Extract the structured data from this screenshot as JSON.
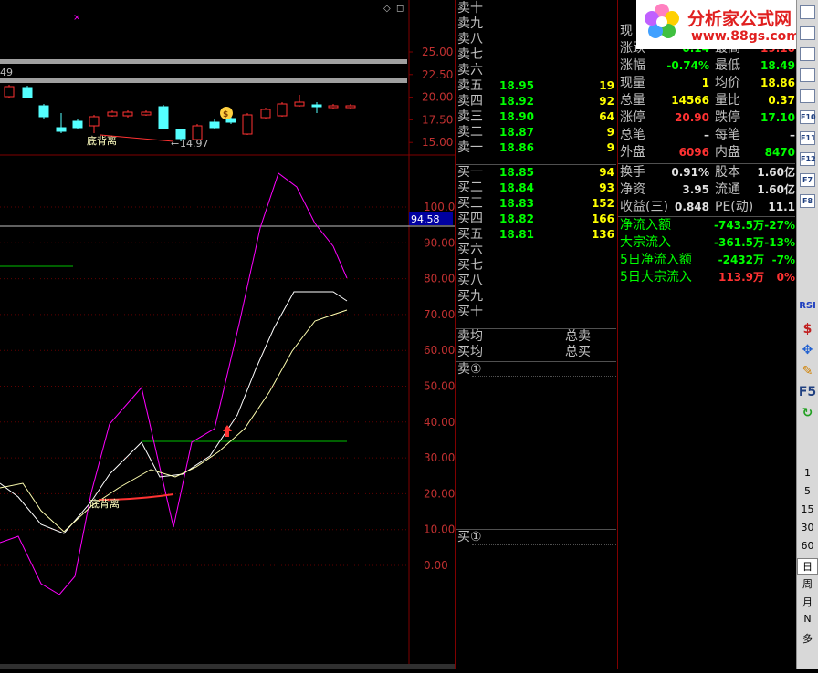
{
  "chart": {
    "price_axis": [
      "25.00",
      "22.50",
      "20.00",
      "17.50",
      "15.00"
    ],
    "indicator_axis": [
      "100.0",
      "90.00",
      "80.00",
      "70.00",
      "60.00",
      "50.00",
      "40.00",
      "30.00",
      "20.00",
      "10.00",
      "0.00"
    ],
    "current_indicator": "94.58",
    "left_value": "49",
    "low_label": "14.97",
    "divergence_label_top": "底背离",
    "divergence_label_bottom": "底背离",
    "colors": {
      "up": "#ff3232",
      "down": "#54ffff",
      "purple": "#ff00ff",
      "white": "#ffffff",
      "green": "#00c000"
    }
  },
  "orderbook": {
    "sell": [
      {
        "label": "卖十",
        "price": "",
        "vol": ""
      },
      {
        "label": "卖九",
        "price": "",
        "vol": ""
      },
      {
        "label": "卖八",
        "price": "",
        "vol": ""
      },
      {
        "label": "卖七",
        "price": "",
        "vol": ""
      },
      {
        "label": "卖六",
        "price": "",
        "vol": ""
      },
      {
        "label": "卖五",
        "price": "18.95",
        "vol": "19"
      },
      {
        "label": "卖四",
        "price": "18.92",
        "vol": "92"
      },
      {
        "label": "卖三",
        "price": "18.90",
        "vol": "64"
      },
      {
        "label": "卖二",
        "price": "18.87",
        "vol": "9"
      },
      {
        "label": "卖一",
        "price": "18.86",
        "vol": "9"
      }
    ],
    "buy": [
      {
        "label": "买一",
        "price": "18.85",
        "vol": "94"
      },
      {
        "label": "买二",
        "price": "18.84",
        "vol": "93"
      },
      {
        "label": "买三",
        "price": "18.83",
        "vol": "152"
      },
      {
        "label": "买四",
        "price": "18.82",
        "vol": "166"
      },
      {
        "label": "买五",
        "price": "18.81",
        "vol": "136"
      },
      {
        "label": "买六",
        "price": "",
        "vol": ""
      },
      {
        "label": "买七",
        "price": "",
        "vol": ""
      },
      {
        "label": "买八",
        "price": "",
        "vol": ""
      },
      {
        "label": "买九",
        "price": "",
        "vol": ""
      },
      {
        "label": "买十",
        "price": "",
        "vol": ""
      }
    ],
    "sell_avg_label": "卖均",
    "total_sell_label": "总卖",
    "buy_avg_label": "买均",
    "total_buy_label": "总买",
    "sell_queue_label": "卖①",
    "buy_queue_label": "买①"
  },
  "stats": {
    "rows": [
      {
        "l1": "现",
        "v1": "",
        "l2": "",
        "v2": ""
      },
      {
        "l1": "涨跌",
        "v1": "0.14",
        "l2": "最高",
        "v2": "19.10"
      },
      {
        "l1": "涨幅",
        "v1": "-0.74%",
        "l2": "最低",
        "v2": "18.49"
      },
      {
        "l1": "现量",
        "v1": "1",
        "l2": "均价",
        "v2": "18.86"
      },
      {
        "l1": "总量",
        "v1": "14566",
        "l2": "量比",
        "v2": "0.37"
      },
      {
        "l1": "涨停",
        "v1": "20.90",
        "l2": "跌停",
        "v2": "17.10"
      },
      {
        "l1": "总笔",
        "v1": "–",
        "l2": "每笔",
        "v2": "–"
      },
      {
        "l1": "外盘",
        "v1": "6096",
        "l2": "内盘",
        "v2": "8470"
      }
    ],
    "rows2": [
      {
        "l1": "换手",
        "v1": "0.91%",
        "l2": "股本",
        "v2": "1.60亿"
      },
      {
        "l1": "净资",
        "v1": "3.95",
        "l2": "流通",
        "v2": "1.60亿"
      },
      {
        "l1": "收益(三)",
        "v1": "0.848",
        "l2": "PE(动)",
        "v2": "11.1"
      }
    ],
    "flows": [
      {
        "label": "净流入额",
        "value": "-743.5万",
        "pct": "-27%"
      },
      {
        "label": "大宗流入",
        "value": "-361.5万",
        "pct": "-13%"
      },
      {
        "label": "5日净流入额",
        "value": "-2432万",
        "pct": "-7%"
      },
      {
        "label": "5日大宗流入",
        "value": "113.9万",
        "pct": "0%"
      }
    ]
  },
  "logo": {
    "title": "分析家公式网",
    "url": "www.88gs.com"
  },
  "toolbar": {
    "icons": [
      "chart-icon",
      "grid-icon",
      "list-icon",
      "table-icon",
      "line-icon",
      "f10-icon",
      "f11-icon",
      "f12-icon",
      "f7-icon",
      "f8-icon"
    ],
    "icon_labels": [
      "",
      "",
      "",
      "",
      "",
      "F10",
      "F11",
      "F12",
      "F7",
      "F8"
    ],
    "buttons": [
      "RSI",
      "$",
      "✥",
      "✎",
      "F5",
      "↻"
    ],
    "periods": [
      "1",
      "5",
      "15",
      "30",
      "60",
      "日",
      "周",
      "月",
      "N",
      "多"
    ]
  }
}
